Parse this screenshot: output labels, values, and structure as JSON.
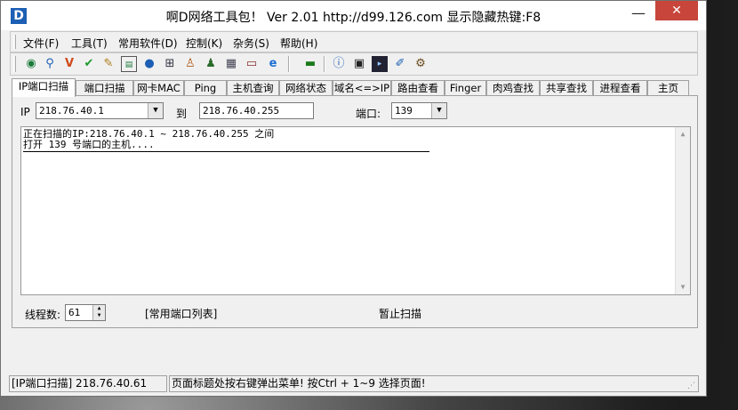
{
  "window": {
    "app_icon_letter": "D",
    "title": "啊D网络工具包！ Ver 2.01   http://d99.126.com   显示隐藏热键:F8",
    "min_glyph": "—",
    "close_glyph": "✕"
  },
  "menu": {
    "items": [
      "文件(F)",
      "工具(T)",
      "常用软件(D)",
      "控制(K)",
      "杂务(S)",
      "帮助(H)"
    ]
  },
  "toolbar": {
    "icons": [
      "globe-icon",
      "magnifier-icon",
      "colorful-v-icon",
      "checkmark-icon",
      "brush-icon",
      "chart-window-icon",
      "earth-icon",
      "network-computers-icon",
      "person-icon",
      "person-search-icon",
      "server-icon",
      "card-icon",
      "ie-icon",
      "network-card-icon",
      "info-icon",
      "monitor-icon",
      "console-icon",
      "pen-icon",
      "gears-icon"
    ]
  },
  "tabs": [
    {
      "label": "IP端口扫描",
      "active": true
    },
    {
      "label": "端口扫描"
    },
    {
      "label": "网卡MAC"
    },
    {
      "label": "Ping"
    },
    {
      "label": "主机查询"
    },
    {
      "label": "网络状态"
    },
    {
      "label": "域名<=>IP"
    },
    {
      "label": "路由查看"
    },
    {
      "label": "Finger"
    },
    {
      "label": "肉鸡查找"
    },
    {
      "label": "共享查找"
    },
    {
      "label": "进程查看"
    },
    {
      "label": "主页"
    }
  ],
  "scan": {
    "ip_label": "IP",
    "ip_start": "218.76.40.1",
    "to_label": "到",
    "ip_end": "218.76.40.255",
    "port_label": "端口:",
    "port_value": "139"
  },
  "output": {
    "lines": [
      "正在扫描的IP:218.76.40.1 ~ 218.76.40.255 之间",
      "打开 139 号端口的主机...."
    ]
  },
  "bottom": {
    "threads_label": "线程数:",
    "threads_value": "61",
    "common_ports_link": "[常用端口列表]",
    "pause_button": "暂止扫描"
  },
  "status": {
    "left": "[IP端口扫描] 218.76.40.61",
    "right": "页面标题处按右键弹出菜单! 按Ctrl + 1~9  选择页面!"
  }
}
